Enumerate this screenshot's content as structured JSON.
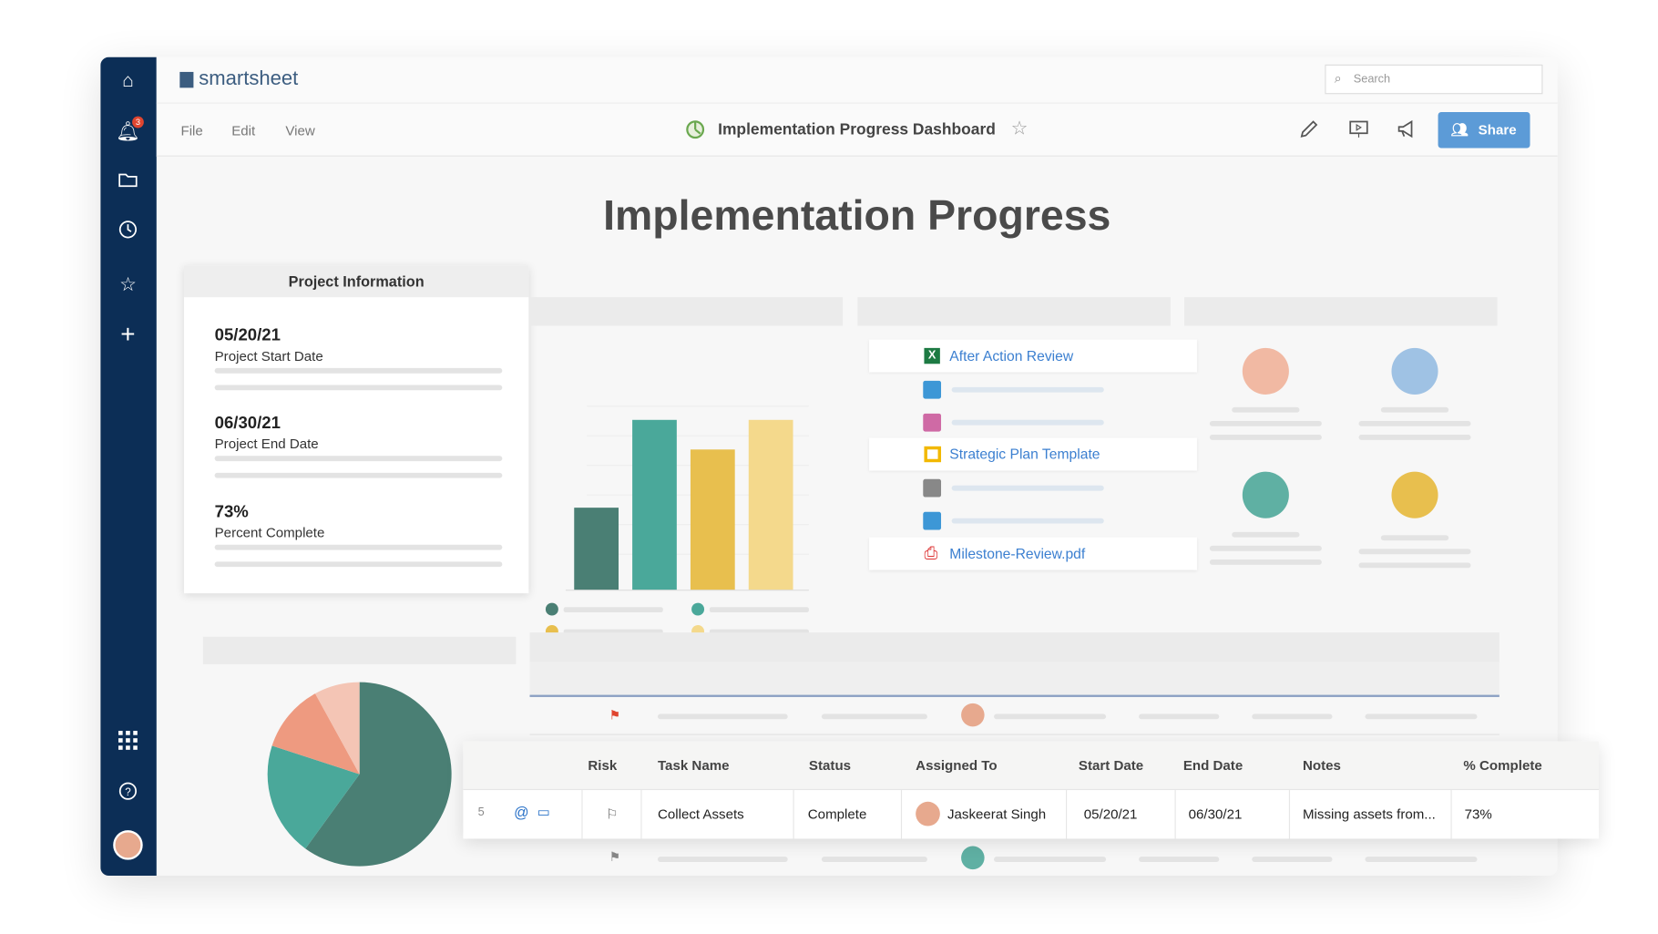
{
  "app": {
    "logo": "smartsheet",
    "search_placeholder": "Search",
    "notification_count": "3"
  },
  "menu": [
    "File",
    "Edit",
    "View"
  ],
  "header": {
    "title": "Implementation Progress Dashboard",
    "share_label": "Share"
  },
  "sidebar": {
    "icons": [
      "home-icon",
      "bell-icon",
      "folder-icon",
      "clock-icon",
      "star-icon",
      "plus-icon",
      "apps-grid-icon",
      "help-icon",
      "user-avatar"
    ]
  },
  "dashboard": {
    "heading": "Implementation Progress",
    "project_info": {
      "title": "Project Information",
      "items": [
        {
          "value": "05/20/21",
          "label": "Project Start Date"
        },
        {
          "value": "06/30/21",
          "label": "Project End Date"
        },
        {
          "value": "73%",
          "label": "Percent Complete"
        }
      ]
    },
    "bar_colors": [
      "#4a7f74",
      "#4aa89a",
      "#e8bf4e",
      "#f4d98c"
    ],
    "files": [
      {
        "name": "After Action Review",
        "icon": "excel-icon"
      },
      {
        "name": "Strategic Plan Template",
        "icon": "slides-icon"
      },
      {
        "name": "Milestone-Review.pdf",
        "icon": "pdf-icon"
      }
    ],
    "pie_colors": [
      "#4a7f74",
      "#4aa89a",
      "#ee9a80",
      "#f4c5b5"
    ]
  },
  "grid": {
    "columns": [
      "Risk",
      "Task Name",
      "Status",
      "Assigned To",
      "Start Date",
      "End Date",
      "Notes",
      "% Complete"
    ],
    "row": {
      "number": "5",
      "task": "Collect Assets",
      "status": "Complete",
      "assigned": "Jaskeerat Singh",
      "start": "05/20/21",
      "end": "06/30/21",
      "notes": "Missing assets from...",
      "complete": "73%"
    }
  }
}
